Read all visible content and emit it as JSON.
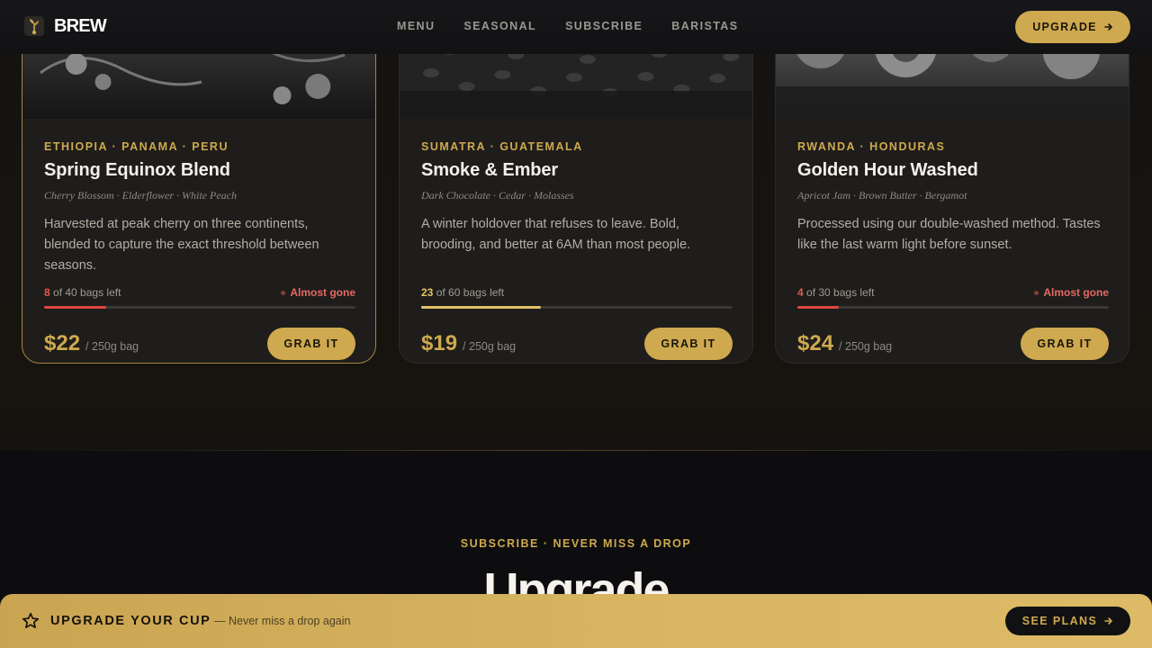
{
  "brand": {
    "name": "BREW",
    "logo_icon": "coffee-plant-icon"
  },
  "nav": {
    "items": [
      {
        "label": "MENU"
      },
      {
        "label": "SEASONAL"
      },
      {
        "label": "SUBSCRIBE"
      },
      {
        "label": "BARISTAS"
      }
    ],
    "upgrade_label": "UPGRADE",
    "upgrade_icon": "arrow-right-icon"
  },
  "products": [
    {
      "origin": "ETHIOPIA · PANAMA · PERU",
      "name": "Spring Equinox Blend",
      "notes": "Cherry Blossom · Elderflower · White Peach",
      "description": "Harvested at peak cherry on three continents, blended to capture the exact threshold between seasons.",
      "stock_left": "8",
      "stock_suffix": "of 40 bags left",
      "stock_fraction": 0.2,
      "status": "Almost gone",
      "price": "$22",
      "unit": "/ 250g bag",
      "cta": "GRAB IT",
      "bar_color": "#e0463f"
    },
    {
      "origin": "SUMATRA · GUATEMALA",
      "name": "Smoke & Ember",
      "notes": "Dark Chocolate · Cedar · Molasses",
      "description": "A winter holdover that refuses to leave. Bold, brooding, and better at 6AM than most people.",
      "stock_left": "23",
      "stock_suffix": "of 60 bags left",
      "stock_fraction": 0.383,
      "status": "",
      "price": "$19",
      "unit": "/ 250g bag",
      "cta": "GRAB IT",
      "bar_color": "#e3c06a"
    },
    {
      "origin": "RWANDA · HONDURAS",
      "name": "Golden Hour Washed",
      "notes": "Apricot Jam · Brown Butter · Bergamot",
      "description": "Processed using our double-washed method. Tastes like the last warm light before sunset.",
      "stock_left": "4",
      "stock_suffix": "of 30 bags left",
      "stock_fraction": 0.133,
      "status": "Almost gone",
      "price": "$24",
      "unit": "/ 250g bag",
      "cta": "GRAB IT",
      "bar_color": "#e0463f"
    }
  ],
  "subscribe": {
    "kicker": "SUBSCRIBE · NEVER MISS A DROP",
    "title": "Upgrade"
  },
  "banner": {
    "icon": "star-icon",
    "title": "UPGRADE YOUR CUP",
    "subtitle": "— Never miss a drop again",
    "cta": "SEE PLANS",
    "cta_icon": "arrow-right-icon"
  },
  "colors": {
    "accent": "#cfa94f",
    "background": "#0e0e10",
    "card": "#1e1d1b",
    "alert": "#e0463f"
  }
}
